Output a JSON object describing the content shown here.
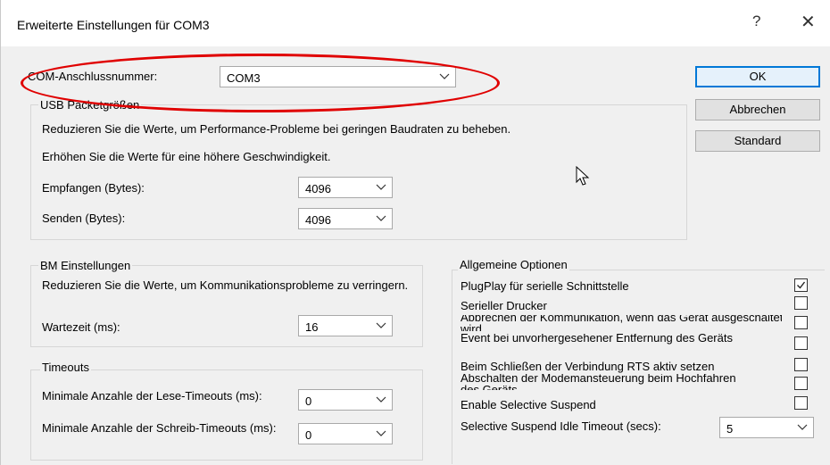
{
  "window": {
    "title": "Erweiterte Einstellungen für COM3",
    "help_glyph": "?",
    "close_glyph": "✕"
  },
  "com_port": {
    "label": "COM-Anschlussnummer:",
    "value": "COM3"
  },
  "buttons": {
    "ok": "OK",
    "cancel": "Abbrechen",
    "default": "Standard"
  },
  "usb": {
    "title": "USB Packetgrößen",
    "text1": "Reduzieren Sie die Werte, um Performance-Probleme bei geringen Baudraten zu beheben.",
    "text2": "Erhöhen Sie die Werte für eine höhere Geschwindigkeit.",
    "receive_label": "Empfangen (Bytes):",
    "receive_value": "4096",
    "send_label": "Senden (Bytes):",
    "send_value": "4096"
  },
  "bm": {
    "title": "BM Einstellungen",
    "text": "Reduzieren Sie die Werte, um Kommunikationsprobleme zu verringern.",
    "latency_label": "Wartezeit (ms):",
    "latency_value": "16"
  },
  "timeouts": {
    "title": "Timeouts",
    "read_label": "Minimale Anzahle der Lese-Timeouts (ms):",
    "read_value": "0",
    "write_label": "Minimale Anzahle der Schreib-Timeouts (ms):",
    "write_value": "0"
  },
  "general": {
    "title": "Allgemeine Optionen",
    "options": [
      {
        "label": "PlugPlay für serielle Schnittstelle",
        "checked": true
      },
      {
        "label": "Serieller Drucker",
        "checked": false
      },
      {
        "label": "Abbrechen der Kommunikation, wenn das Gerät ausgeschaltet wird",
        "checked": false
      },
      {
        "label": "Event bei unvorhergesehener Entfernung des Geräts",
        "checked": false
      },
      {
        "label": "Beim Schließen der Verbindung RTS aktiv setzen",
        "checked": false
      },
      {
        "label": "Abschalten der Modemansteuerung beim Hochfahren des Geräts",
        "checked": false
      },
      {
        "label": "Enable Selective Suspend",
        "checked": false
      }
    ],
    "suspend_timeout_label": "Selective Suspend Idle Timeout (secs):",
    "suspend_timeout_value": "5"
  },
  "colors": {
    "annotation_oval": "#e00000",
    "default_button_border": "#0078d7"
  }
}
